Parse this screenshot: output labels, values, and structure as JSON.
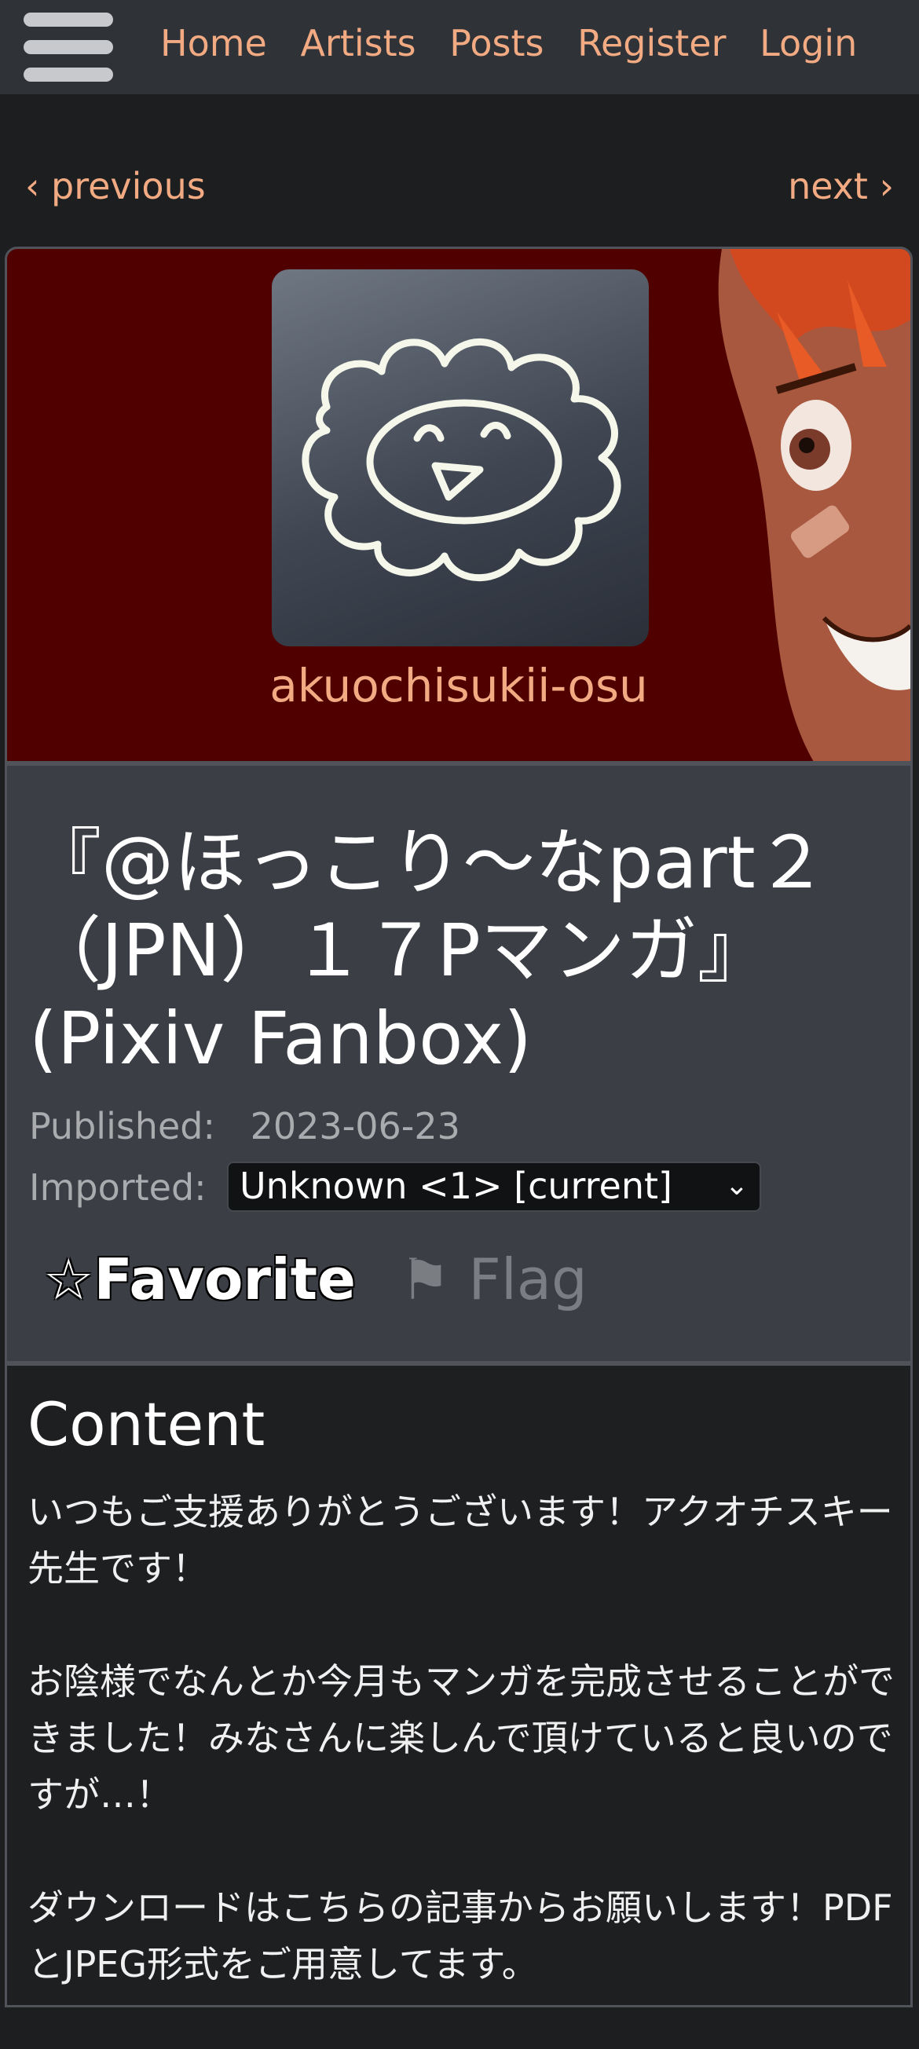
{
  "nav": {
    "links": [
      "Home",
      "Artists",
      "Posts",
      "Register",
      "Login"
    ]
  },
  "pager": {
    "previous": "‹ previous",
    "next": "next ›"
  },
  "artist": {
    "name": "akuochisukii-osu"
  },
  "post": {
    "title": "『@ほっこり～なpart２（JPN）１７Pマンガ』 (Pixiv Fanbox)",
    "published_label": "Published:",
    "published_value": "2023-06-23",
    "imported_label": "Imported:",
    "imported_selected": "Unknown <1> [current]",
    "favorite_label": "☆Favorite",
    "flag_label": "⚑ Flag"
  },
  "content": {
    "heading": "Content",
    "paragraphs": [
      "いつもご支援ありがとうございます！アクオチスキー先生です！",
      "お陰様でなんとか今月もマンガを完成させることができました！みなさんに楽しんで頂けていると良いのですが…！",
      "ダウンロードはこちらの記事からお願いします！PDFとJPEG形式をご用意してます。"
    ]
  },
  "colors": {
    "accent": "#f2aa83",
    "banner_bg": "#510000",
    "nav_bg": "#2f3237",
    "meta_bg": "#3b3e45"
  }
}
